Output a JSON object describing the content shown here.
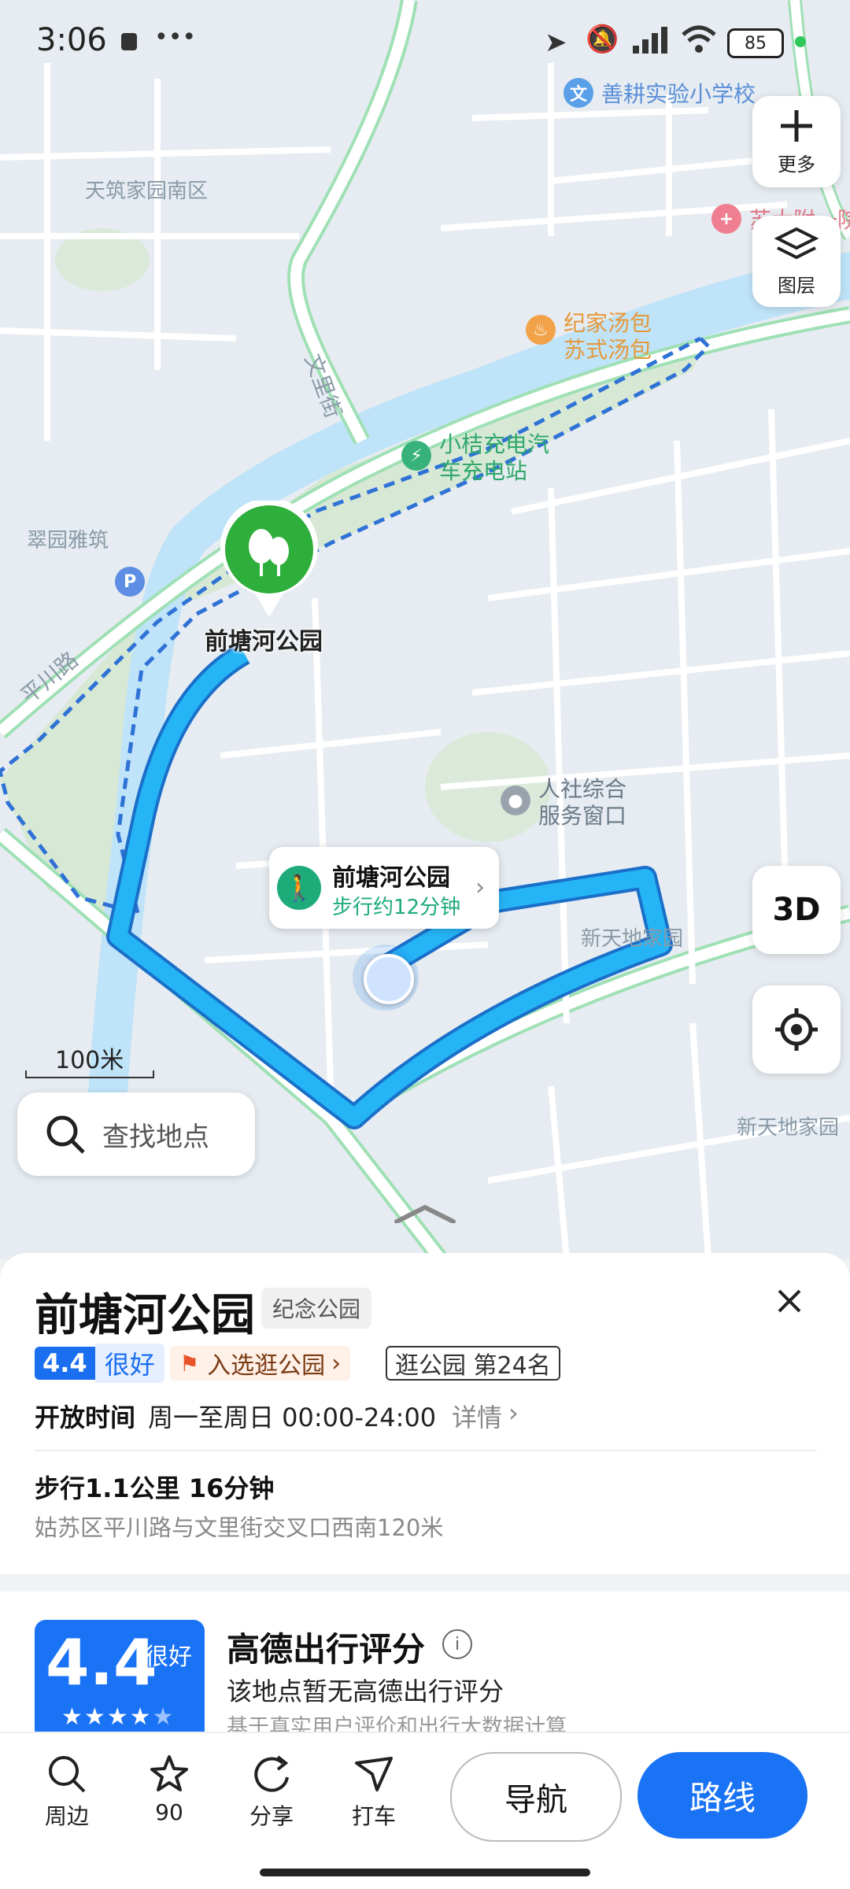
{
  "status_bar": {
    "time": "3:06",
    "more": "•••",
    "battery": "85"
  },
  "map": {
    "labels": {
      "school": "善耕实验小学校",
      "compound_n": "天筑家园南区",
      "road_wenli": "文里街",
      "charging": "小桔充电汽车充电站",
      "restaurant": "纪家汤包苏式汤包",
      "cuiyuan": "翠园雅筑",
      "road_pingchuan": "平川路",
      "renshe": "人社综合服务窗口",
      "xintiandi1": "新天地家园",
      "xintiandi2": "新天地家园",
      "hospital": "苏大附一院",
      "park": "前塘河公园"
    },
    "scale": "100米",
    "zoom_more": "更多",
    "layers": "图层",
    "btn_3d": "3D",
    "search_placeholder": "查找地点",
    "walk_bubble": {
      "title": "前塘河公园",
      "sub": "步行约12分钟"
    },
    "colors": {
      "route": "#1a9df0",
      "river": "#bfe3f8",
      "park": "#d7e8d5",
      "road_green": "#9fe0b5"
    }
  },
  "place": {
    "name": "前塘河公园",
    "category": "纪念公园",
    "rating": "4.4",
    "rating_word": "很好",
    "award": "入选逛公园",
    "rank": "逛公园 第24名",
    "hours_label": "开放时间",
    "hours": "周一至周日 00:00-24:00",
    "hours_more": "详情",
    "walk": "步行1.1公里 16分钟",
    "address": "姑苏区平川路与文里街交叉口西南120米"
  },
  "rating_card": {
    "score": "4.4",
    "word": "很好",
    "stars": 4.4,
    "title": "高德出行评分",
    "desc": "该地点暂无高德出行评分",
    "note": "基于真实用户评价和出行大数据计算"
  },
  "bottom_nav": {
    "nearby": "周边",
    "favorites": "90",
    "share": "分享",
    "taxi": "打车",
    "navigate": "导航",
    "route": "路线"
  }
}
